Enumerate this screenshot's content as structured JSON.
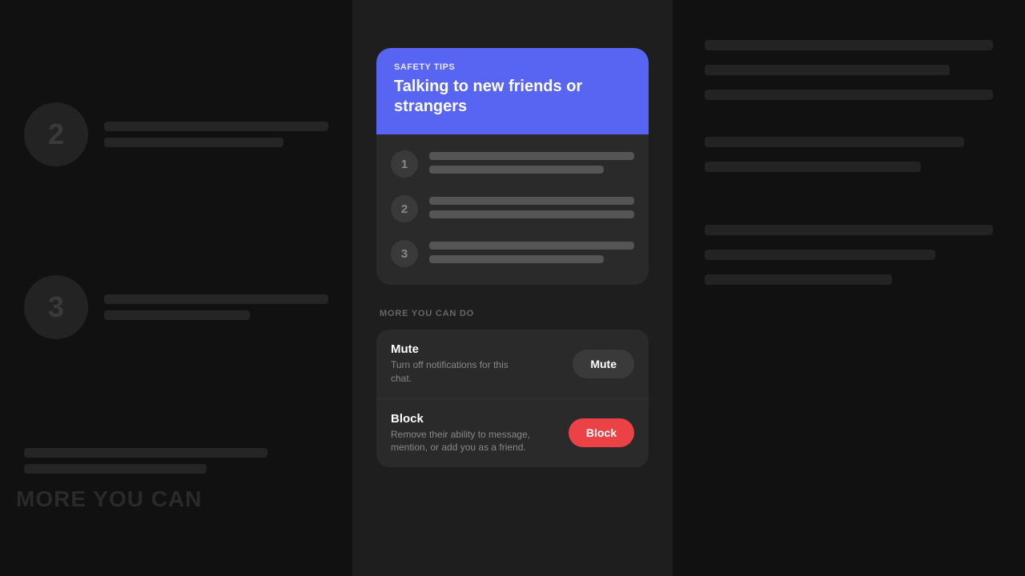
{
  "bg": {
    "left": {
      "numbers": [
        "2",
        "3"
      ],
      "bottom_text": "MORE YOU CAN"
    },
    "right": {
      "lines": [
        "full",
        "medium",
        "full",
        "short",
        "full",
        "medium",
        "short",
        "full",
        "medium"
      ]
    }
  },
  "safety_tips": {
    "label": "SAFETY TIPS",
    "title": "Talking to new friends or strangers",
    "items": [
      {
        "number": "1"
      },
      {
        "number": "2"
      },
      {
        "number": "3"
      }
    ]
  },
  "more_section": {
    "label": "MORE YOU CAN DO",
    "items": [
      {
        "title": "Mute",
        "description": "Turn off notifications for this chat.",
        "button_label": "Mute"
      },
      {
        "title": "Block",
        "description": "Remove their ability to message, mention, or add you as a friend.",
        "button_label": "Block"
      }
    ]
  }
}
